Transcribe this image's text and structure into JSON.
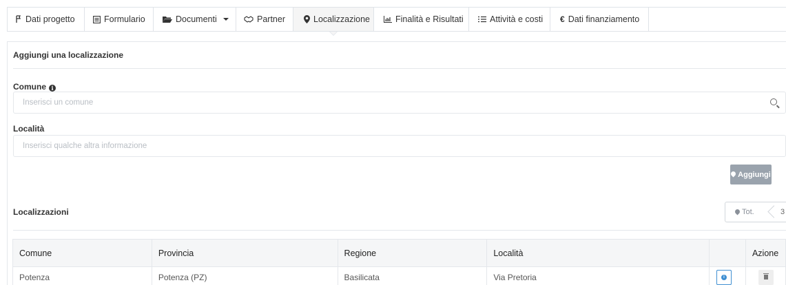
{
  "tabs": [
    {
      "label": "Dati progetto",
      "icon": "project-icon"
    },
    {
      "label": "Formulario",
      "icon": "form-icon"
    },
    {
      "label": "Documenti",
      "icon": "folder-icon"
    },
    {
      "label": "Partner",
      "icon": "handshake-icon"
    },
    {
      "label": "Localizzazione",
      "icon": "map-marker-icon"
    },
    {
      "label": "Finalità e Risultati",
      "icon": "chart-icon"
    },
    {
      "label": "Attività e costi",
      "icon": "list-icon"
    },
    {
      "label": "Dati finanziamento",
      "icon": "euro-icon"
    }
  ],
  "form": {
    "title": "Aggiungi una localizzazione",
    "comune_label": "Comune",
    "comune_placeholder": "Inserisci un comune",
    "localita_label": "Località",
    "localita_placeholder": "Inserisci qualche altra informazione",
    "add_button": "Aggiungi"
  },
  "list": {
    "title": "Localizzazioni",
    "tot_label": "Tot.",
    "tot_count": "3"
  },
  "table": {
    "headers": [
      "Comune",
      "Provincia",
      "Regione",
      "Località",
      "",
      "Azione"
    ],
    "rows": [
      {
        "comune": "Potenza",
        "provincia": "Potenza (PZ)",
        "regione": "Basilicata",
        "localita": "Via Pretoria"
      }
    ]
  },
  "colors": {
    "accent": "#3f8fd2",
    "button_disabled": "#9aa3ad"
  }
}
